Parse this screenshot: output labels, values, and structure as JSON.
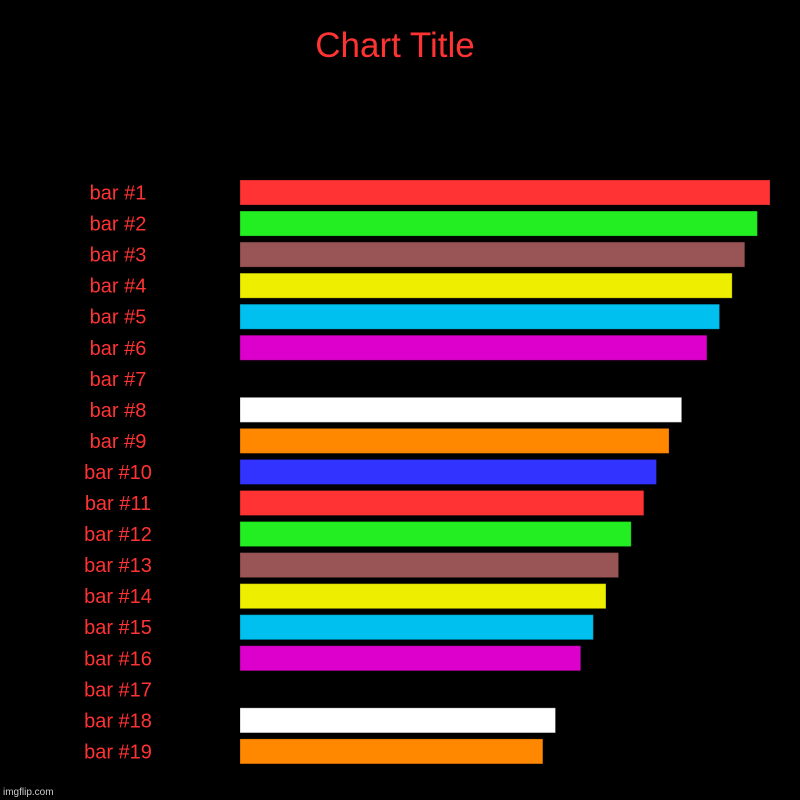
{
  "chart_data": {
    "type": "bar",
    "orientation": "horizontal",
    "title": "Chart Title",
    "xlabel": "",
    "ylabel": "",
    "grid": false,
    "legend": "none",
    "xlim": [
      0,
      42
    ],
    "categories": [
      "bar #1",
      "bar #2",
      "bar #3",
      "bar #4",
      "bar #5",
      "bar #6",
      "bar #7",
      "bar #8",
      "bar #9",
      "bar #10",
      "bar #11",
      "bar #12",
      "bar #13",
      "bar #14",
      "bar #15",
      "bar #16",
      "bar #17",
      "bar #18",
      "bar #19"
    ],
    "values": [
      42,
      41,
      40,
      39,
      38,
      37,
      null,
      35,
      34,
      33,
      32,
      31,
      30,
      29,
      28,
      27,
      null,
      25,
      24
    ],
    "colors": [
      "#FF3333",
      "#22EE22",
      "#995555",
      "#EEEE00",
      "#00C0F0",
      "#DD00CC",
      "#000000",
      "#FFFFFF",
      "#FF8800",
      "#3333FF",
      "#FF3333",
      "#22EE22",
      "#995555",
      "#EEEE00",
      "#00C0F0",
      "#DD00CC",
      "#000000",
      "#FFFFFF",
      "#FF8800"
    ]
  },
  "theme": {
    "background": "#000000",
    "text_color": "#FF3333"
  },
  "watermark": "imgflip.com"
}
